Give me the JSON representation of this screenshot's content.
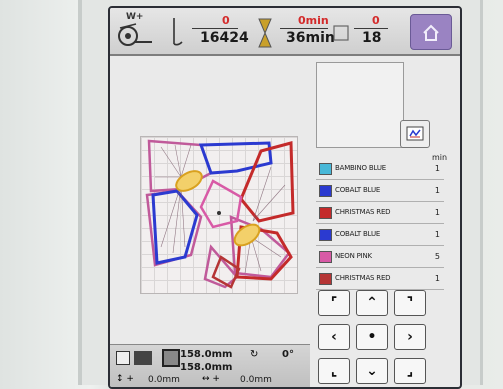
{
  "topbar": {
    "thread_button_label": "W+",
    "stitch_current": "0",
    "stitch_total": "16424",
    "time_current": "0min",
    "time_total": "36min",
    "color_current": "0",
    "color_total": "18"
  },
  "threads": {
    "min_header": "min",
    "items": [
      {
        "name": "BAMBINO BLUE",
        "minutes": "1",
        "color": "#48b8d8"
      },
      {
        "name": "COBALT BLUE",
        "minutes": "1",
        "color": "#2b3ad0"
      },
      {
        "name": "CHRISTMAS RED",
        "minutes": "1",
        "color": "#c42a2a"
      },
      {
        "name": "COBALT BLUE",
        "minutes": "1",
        "color": "#2b3ad0"
      },
      {
        "name": "NEON PINK",
        "minutes": "5",
        "color": "#d85aa6"
      },
      {
        "name": "CHRISTMAS RED",
        "minutes": "1",
        "color": "#b53535"
      }
    ]
  },
  "bottom": {
    "width": "158.0mm",
    "height": "158.0mm",
    "rotation": "0°",
    "offset_y": "0.0mm",
    "offset_x": "0.0mm"
  },
  "colors": {
    "home_button": "#9a83c2",
    "pad_border": "#555555"
  }
}
